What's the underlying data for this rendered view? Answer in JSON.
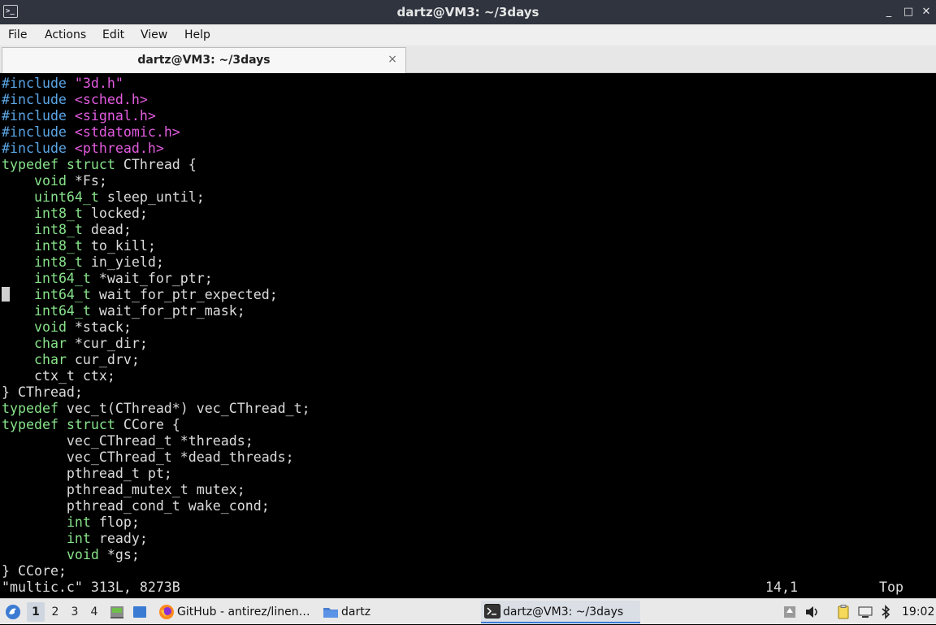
{
  "window": {
    "title": "dartz@VM3: ~/3days",
    "icon_label": ">_",
    "controls": {
      "minimize": "_",
      "maximize": "□",
      "close": "✕"
    }
  },
  "menu": {
    "items": [
      "File",
      "Actions",
      "Edit",
      "View",
      "Help"
    ]
  },
  "tab": {
    "label": "dartz@VM3: ~/3days",
    "close": "×"
  },
  "editor": {
    "lines": [
      [
        {
          "t": "#include ",
          "c": "pp"
        },
        {
          "t": "\"3d.h\"",
          "c": "str"
        }
      ],
      [
        {
          "t": "#include ",
          "c": "pp"
        },
        {
          "t": "<sched.h>",
          "c": "str"
        }
      ],
      [
        {
          "t": "#include ",
          "c": "pp"
        },
        {
          "t": "<signal.h>",
          "c": "str"
        }
      ],
      [
        {
          "t": "#include ",
          "c": "pp"
        },
        {
          "t": "<stdatomic.h>",
          "c": "str"
        }
      ],
      [
        {
          "t": "#include ",
          "c": "pp"
        },
        {
          "t": "<pthread.h>",
          "c": "str"
        }
      ],
      [
        {
          "t": "typedef struct",
          "c": "kw"
        },
        {
          "t": " CThread {",
          "c": ""
        }
      ],
      [
        {
          "t": "    ",
          "c": ""
        },
        {
          "t": "void",
          "c": "kw"
        },
        {
          "t": " *Fs;",
          "c": ""
        }
      ],
      [
        {
          "t": "    ",
          "c": ""
        },
        {
          "t": "uint64_t",
          "c": "kw"
        },
        {
          "t": " sleep_until;",
          "c": ""
        }
      ],
      [
        {
          "t": "    ",
          "c": ""
        },
        {
          "t": "int8_t",
          "c": "kw"
        },
        {
          "t": " locked;",
          "c": ""
        }
      ],
      [
        {
          "t": "    ",
          "c": ""
        },
        {
          "t": "int8_t",
          "c": "kw"
        },
        {
          "t": " dead;",
          "c": ""
        }
      ],
      [
        {
          "t": "    ",
          "c": ""
        },
        {
          "t": "int8_t",
          "c": "kw"
        },
        {
          "t": " to_kill;",
          "c": ""
        }
      ],
      [
        {
          "t": "    ",
          "c": ""
        },
        {
          "t": "int8_t",
          "c": "kw"
        },
        {
          "t": " in_yield;",
          "c": ""
        }
      ],
      [
        {
          "t": "    ",
          "c": ""
        },
        {
          "t": "int64_t",
          "c": "kw"
        },
        {
          "t": " *wait_for_ptr;",
          "c": ""
        }
      ],
      [
        {
          "t": "    ",
          "c": ""
        },
        {
          "t": "int64_t",
          "c": "kw"
        },
        {
          "t": " wait_for_ptr_expected;",
          "c": ""
        }
      ],
      [
        {
          "t": "    ",
          "c": ""
        },
        {
          "t": "int64_t",
          "c": "kw"
        },
        {
          "t": " wait_for_ptr_mask;",
          "c": ""
        }
      ],
      [
        {
          "t": "    ",
          "c": ""
        },
        {
          "t": "void",
          "c": "kw"
        },
        {
          "t": " *stack;",
          "c": ""
        }
      ],
      [
        {
          "t": "    ",
          "c": ""
        },
        {
          "t": "char",
          "c": "kw"
        },
        {
          "t": " *cur_dir;",
          "c": ""
        }
      ],
      [
        {
          "t": "    ",
          "c": ""
        },
        {
          "t": "char",
          "c": "kw"
        },
        {
          "t": " cur_drv;",
          "c": ""
        }
      ],
      [
        {
          "t": "    ctx_t ctx;",
          "c": ""
        }
      ],
      [
        {
          "t": "} CThread;",
          "c": ""
        }
      ],
      [
        {
          "t": "typedef",
          "c": "kw"
        },
        {
          "t": " vec_t(CThread*) vec_CThread_t;",
          "c": ""
        }
      ],
      [
        {
          "t": "typedef struct",
          "c": "kw"
        },
        {
          "t": " CCore {",
          "c": ""
        }
      ],
      [
        {
          "t": "        vec_CThread_t *threads;",
          "c": ""
        }
      ],
      [
        {
          "t": "        vec_CThread_t *dead_threads;",
          "c": ""
        }
      ],
      [
        {
          "t": "        pthread_t pt;",
          "c": ""
        }
      ],
      [
        {
          "t": "        pthread_mutex_t mutex;",
          "c": ""
        }
      ],
      [
        {
          "t": "        pthread_cond_t wake_cond;",
          "c": ""
        }
      ],
      [
        {
          "t": "        ",
          "c": ""
        },
        {
          "t": "int",
          "c": "kw"
        },
        {
          "t": " flop;",
          "c": ""
        }
      ],
      [
        {
          "t": "        ",
          "c": ""
        },
        {
          "t": "int",
          "c": "kw"
        },
        {
          "t": " ready;",
          "c": ""
        }
      ],
      [
        {
          "t": "        ",
          "c": ""
        },
        {
          "t": "void",
          "c": "kw"
        },
        {
          "t": " *gs;",
          "c": ""
        }
      ],
      [
        {
          "t": "} CCore;",
          "c": ""
        }
      ]
    ],
    "status_file": "\"multic.c\" 313L, 8273B",
    "status_position": "14,1",
    "status_scroll": "Top"
  },
  "taskbar": {
    "workspaces": [
      "1",
      "2",
      "3",
      "4"
    ],
    "active_workspace": "1",
    "tasks": [
      {
        "label": "GitHub - antirez/linen…",
        "icon": "firefox-icon"
      },
      {
        "label": "dartz",
        "icon": "folder-icon"
      },
      {
        "label": "dartz@VM3: ~/3days",
        "icon": "terminal-icon"
      }
    ],
    "clock": "19:02"
  },
  "colors": {
    "keyword": "#87e38a",
    "preprocessor": "#5aa6e6",
    "string": "#e35ce0",
    "text": "#dcdcdc",
    "titlebar": "#2f343f"
  }
}
